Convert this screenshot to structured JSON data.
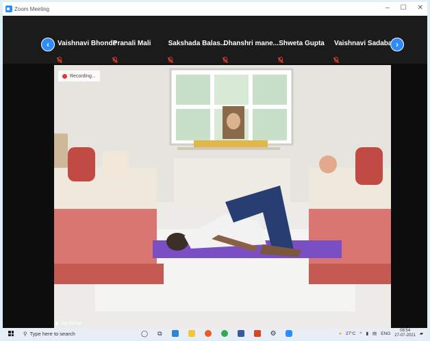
{
  "window": {
    "title": "Zoom Meeting",
    "controls": [
      "–",
      "☐",
      "✕"
    ]
  },
  "participants": [
    {
      "name": "Vaishnavi Bhonde",
      "muted": true
    },
    {
      "name": "Pranali Mali",
      "muted": true
    },
    {
      "name": "Sakshada  Balas...",
      "muted": true
    },
    {
      "name": "Dhanshri  mane...",
      "muted": true
    },
    {
      "name": "Shweta Gupta",
      "muted": true
    },
    {
      "name": "Vaishnavi Sadabal",
      "muted": true
    }
  ],
  "nav": {
    "prev": "‹",
    "next": "›"
  },
  "video": {
    "recording_label": "Recording...",
    "speaker_name": "Jay Borse"
  },
  "taskbar": {
    "search_placeholder": "Type here to search",
    "weather": "27°C",
    "language": "ENG",
    "time": "08:54",
    "date": "27-07-2021"
  },
  "colors": {
    "zoom_blue": "#2d8cff",
    "mat": "#7b4fc4",
    "sofa": "#c55a52",
    "muted_red": "#d83a2b"
  }
}
